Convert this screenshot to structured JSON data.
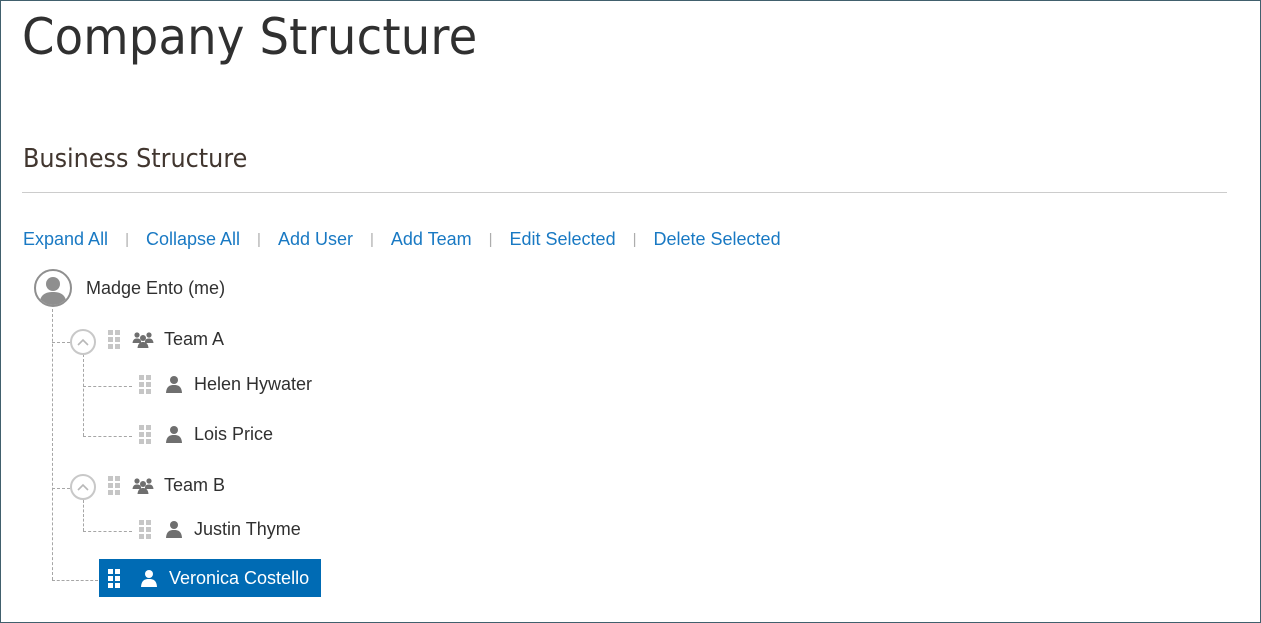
{
  "page": {
    "title": "Company Structure"
  },
  "section": {
    "title": "Business Structure"
  },
  "actions": [
    {
      "label": "Expand All"
    },
    {
      "label": "Collapse All"
    },
    {
      "label": "Add User"
    },
    {
      "label": "Add Team"
    },
    {
      "label": "Edit Selected"
    },
    {
      "label": "Delete Selected"
    }
  ],
  "tree": {
    "root": {
      "name": "Madge Ento (me)",
      "icon": "user-avatar-icon"
    },
    "teams": [
      {
        "name": "Team A",
        "icon": "team-icon",
        "expanded": true,
        "members": [
          {
            "name": "Helen Hywater",
            "icon": "user-icon"
          },
          {
            "name": "Lois Price",
            "icon": "user-icon"
          }
        ]
      },
      {
        "name": "Team B",
        "icon": "team-icon",
        "expanded": true,
        "members": [
          {
            "name": "Justin Thyme",
            "icon": "user-icon"
          }
        ]
      }
    ],
    "direct_user": {
      "name": "Veronica Costello",
      "icon": "user-icon",
      "selected": true
    }
  },
  "colors": {
    "link": "#1979c3",
    "selected": "#006bb4",
    "border": "#41606d"
  }
}
